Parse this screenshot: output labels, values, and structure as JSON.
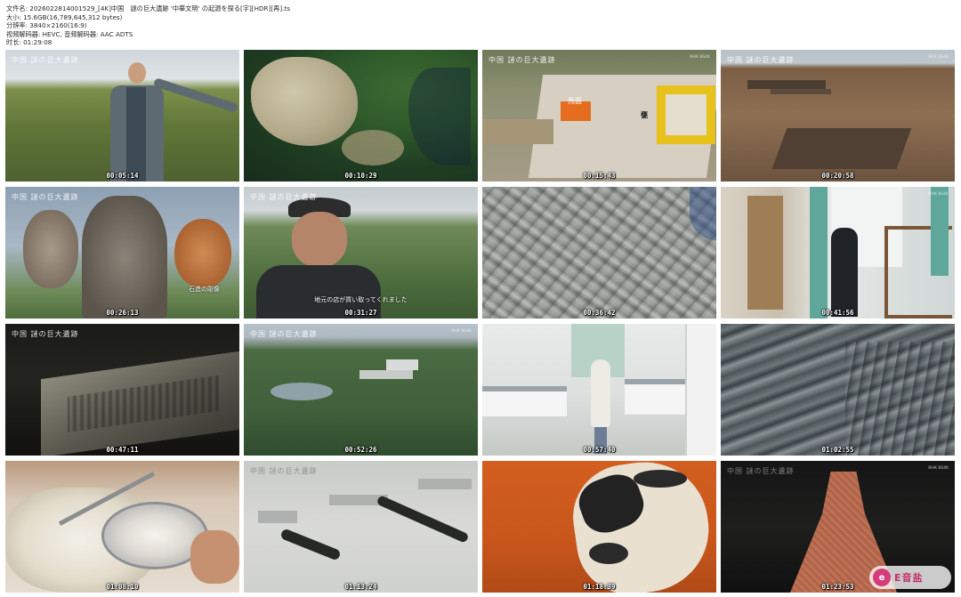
{
  "header": {
    "file_name": "文件名: 2026022814001529_[4K]中国　謎の巨大遺跡 '中華文明' の起源を探る[字][HDR][再].ts",
    "file_size": "大小: 15.6GB(16,789,645,312 bytes)",
    "resolution": "分辨率: 3840×2160(16:9)",
    "codec": "视频解码器: HEVC, 音频解码器: AAC ADTS",
    "duration": "时长: 01:29:08"
  },
  "logo_text": "中国 謎の巨大遺跡",
  "watermark": "NHK BS4K",
  "site_logo": {
    "glyph": "e",
    "text": "E音盐"
  },
  "thumbnails": [
    {
      "time": "00:05:14",
      "subtitle": ""
    },
    {
      "time": "00:10:29",
      "subtitle": ""
    },
    {
      "time": "00:15:43",
      "subtitle": "",
      "labels": [
        "馬面",
        "甕"
      ]
    },
    {
      "time": "00:20:58",
      "subtitle": ""
    },
    {
      "time": "00:26:13",
      "subtitle": "石造の彫像"
    },
    {
      "time": "00:31:27",
      "subtitle": "地元の店が買い取ってくれました"
    },
    {
      "time": "00:36:42",
      "subtitle": ""
    },
    {
      "time": "00:41:56",
      "subtitle": ""
    },
    {
      "time": "00:47:11",
      "subtitle": ""
    },
    {
      "time": "00:52:26",
      "subtitle": ""
    },
    {
      "time": "00:57:40",
      "subtitle": ""
    },
    {
      "time": "01:02:55",
      "subtitle": ""
    },
    {
      "time": "01:08:10",
      "subtitle": ""
    },
    {
      "time": "01:13:24",
      "subtitle": ""
    },
    {
      "time": "01:18:39",
      "subtitle": ""
    },
    {
      "time": "01:23:53",
      "subtitle": ""
    }
  ]
}
